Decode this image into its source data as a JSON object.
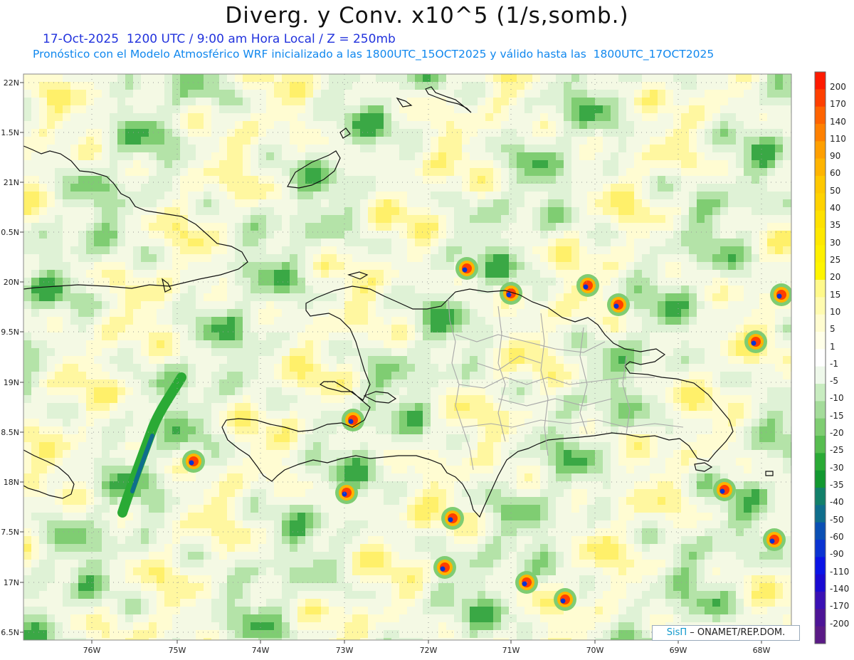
{
  "header": {
    "title": "Diverg. y Conv. x10^5 (1/s,somb.)",
    "line1": "17-Oct-2025  1200 UTC / 9:00 am Hora Local / Z = 250mb",
    "line2": "Pronóstico con el Modelo Atmosférico WRF inicializado a las 1800UTC_15OCT2025 y válido hasta las  1800UTC_17OCT2025"
  },
  "map": {
    "lat_ticks": [
      "22N",
      "1.5N",
      "21N",
      "0.5N",
      "20N",
      "9.5N",
      "19N",
      "8.5N",
      "18N",
      "7.5N",
      "17N",
      "6.5N"
    ],
    "lon_ticks": [
      "76W",
      "75W",
      "74W",
      "73W",
      "72W",
      "71W",
      "70W",
      "69W",
      "68W"
    ]
  },
  "colorbar": {
    "labels": [
      "200",
      "170",
      "140",
      "110",
      "90",
      "60",
      "50",
      "40",
      "35",
      "30",
      "25",
      "20",
      "15",
      "10",
      "5",
      "1",
      "-1",
      "-5",
      "-10",
      "-15",
      "-20",
      "-25",
      "-30",
      "-35",
      "-40",
      "-50",
      "-60",
      "-90",
      "-110",
      "-140",
      "-170",
      "-200"
    ],
    "colors": [
      "#ff1a00",
      "#ff3f00",
      "#ff6300",
      "#ff8000",
      "#ff9f00",
      "#ffb400",
      "#ffc800",
      "#ffd200",
      "#ffe100",
      "#ffe800",
      "#fff000",
      "#fff500",
      "#fff98a",
      "#fffbb0",
      "#fffcd0",
      "#ffffe8",
      "#ffffff",
      "#eef8ea",
      "#c8ecc0",
      "#a4dc9a",
      "#7fcd72",
      "#57bd50",
      "#2aaa35",
      "#129830",
      "#12806a",
      "#0f6e8c",
      "#0a4fb4",
      "#0a33d2",
      "#0a14e6",
      "#1a0ad2",
      "#3a10b4",
      "#4d1496",
      "#5a1a86"
    ]
  },
  "credit": {
    "brand": "SisΠ",
    "text": " – ONAMET/REP.DOM."
  }
}
